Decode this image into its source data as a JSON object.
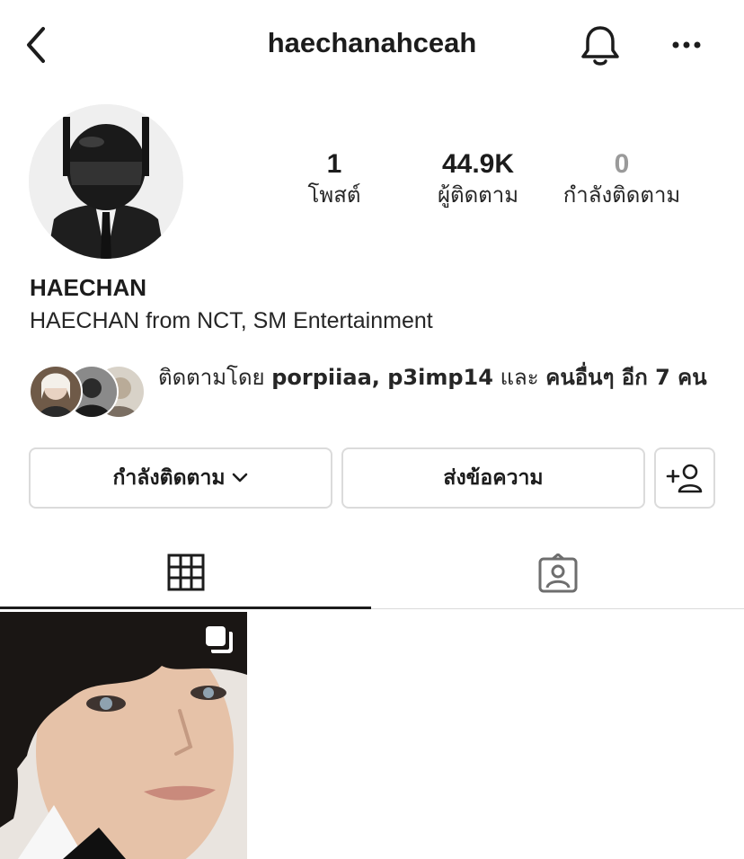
{
  "header": {
    "username": "haechanahceah",
    "back_icon": "chevron-left-icon",
    "bell_icon": "bell-icon",
    "more_icon": "more-horizontal-icon"
  },
  "profile": {
    "display_name": "HAECHAN",
    "bio": "HAECHAN from NCT, SM Entertainment"
  },
  "stats": {
    "posts": {
      "value": "1",
      "label": "โพสต์"
    },
    "followers": {
      "value": "44.9K",
      "label": "ผู้ติดตาม"
    },
    "following": {
      "value": "0",
      "label": "กำลังติดตาม"
    }
  },
  "followed_by": {
    "prefix": "ติดตามโดย ",
    "user1": "porpiiaa",
    "separator": ", ",
    "user2": "p3imp14",
    "and": " และ ",
    "others": "คนอื่นๆ อีก 7 คน"
  },
  "actions": {
    "following_label": "กำลังติดตาม",
    "message_label": "ส่งข้อความ",
    "add_user_icon": "add-person-icon"
  },
  "tabs": {
    "grid_icon": "grid-icon",
    "tagged_icon": "tagged-person-icon"
  },
  "colors": {
    "text": "#262626",
    "muted": "#9a9a9a",
    "border": "#dbdbdb",
    "active_tab": "#1c1c1c"
  }
}
